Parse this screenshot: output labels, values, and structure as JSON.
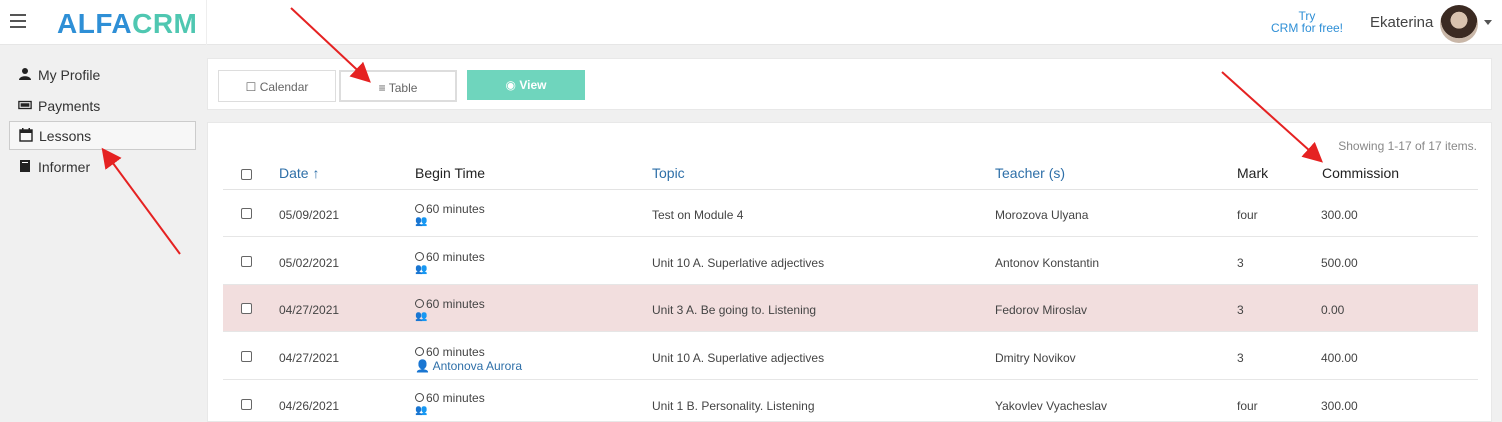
{
  "header": {
    "logo_part1": "ALFA",
    "logo_part2": "CRM",
    "try_line1": "Try",
    "try_line2": "CRM for free!",
    "user_name": "Ekaterina"
  },
  "sidebar": {
    "items": [
      {
        "label": "My Profile",
        "icon": "user-icon"
      },
      {
        "label": "Payments",
        "icon": "money-icon"
      },
      {
        "label": "Lessons",
        "icon": "calendar-icon"
      },
      {
        "label": "Informer",
        "icon": "book-icon"
      }
    ]
  },
  "toolbar": {
    "calendar_label": "Calendar",
    "table_label": "Table",
    "view_label": "View"
  },
  "table": {
    "summary": "Showing 1-17 of 17 items.",
    "headers": {
      "date": "Date ↑",
      "begin_time": "Begin Time",
      "topic": "Topic",
      "teacher": "Teacher (s)",
      "mark": "Mark",
      "commission": "Commission"
    },
    "rows": [
      {
        "date": "05/09/2021",
        "duration": "60 minutes",
        "student": "",
        "topic": "Test on Module 4",
        "teacher": "Morozova Ulyana",
        "mark": "four",
        "commission": "300.00"
      },
      {
        "date": "05/02/2021",
        "duration": "60 minutes",
        "student": "",
        "topic": "Unit 10 A. Superlative adjectives",
        "teacher": "Antonov Konstantin",
        "mark": "3",
        "commission": "500.00"
      },
      {
        "date": "04/27/2021",
        "duration": "60 minutes",
        "student": "",
        "topic": "Unit 3 A. Be going to. Listening",
        "teacher": "Fedorov Miroslav",
        "mark": "3",
        "commission": "0.00"
      },
      {
        "date": "04/27/2021",
        "duration": "60 minutes",
        "student": "Antonova Aurora",
        "topic": "Unit 10 A. Superlative adjectives",
        "teacher": "Dmitry Novikov",
        "mark": "3",
        "commission": "400.00"
      },
      {
        "date": "04/26/2021",
        "duration": "60 minutes",
        "student": "",
        "topic": "Unit 1 B. Personality. Listening",
        "teacher": "Yakovlev Vyacheslav",
        "mark": "four",
        "commission": "300.00"
      }
    ]
  },
  "colors": {
    "brand_blue": "#2e8fd6",
    "brand_teal": "#4fc7b1",
    "view_button": "#6fd5bd",
    "highlight_row": "#f2dede",
    "annotation_arrow": "#e52222"
  }
}
